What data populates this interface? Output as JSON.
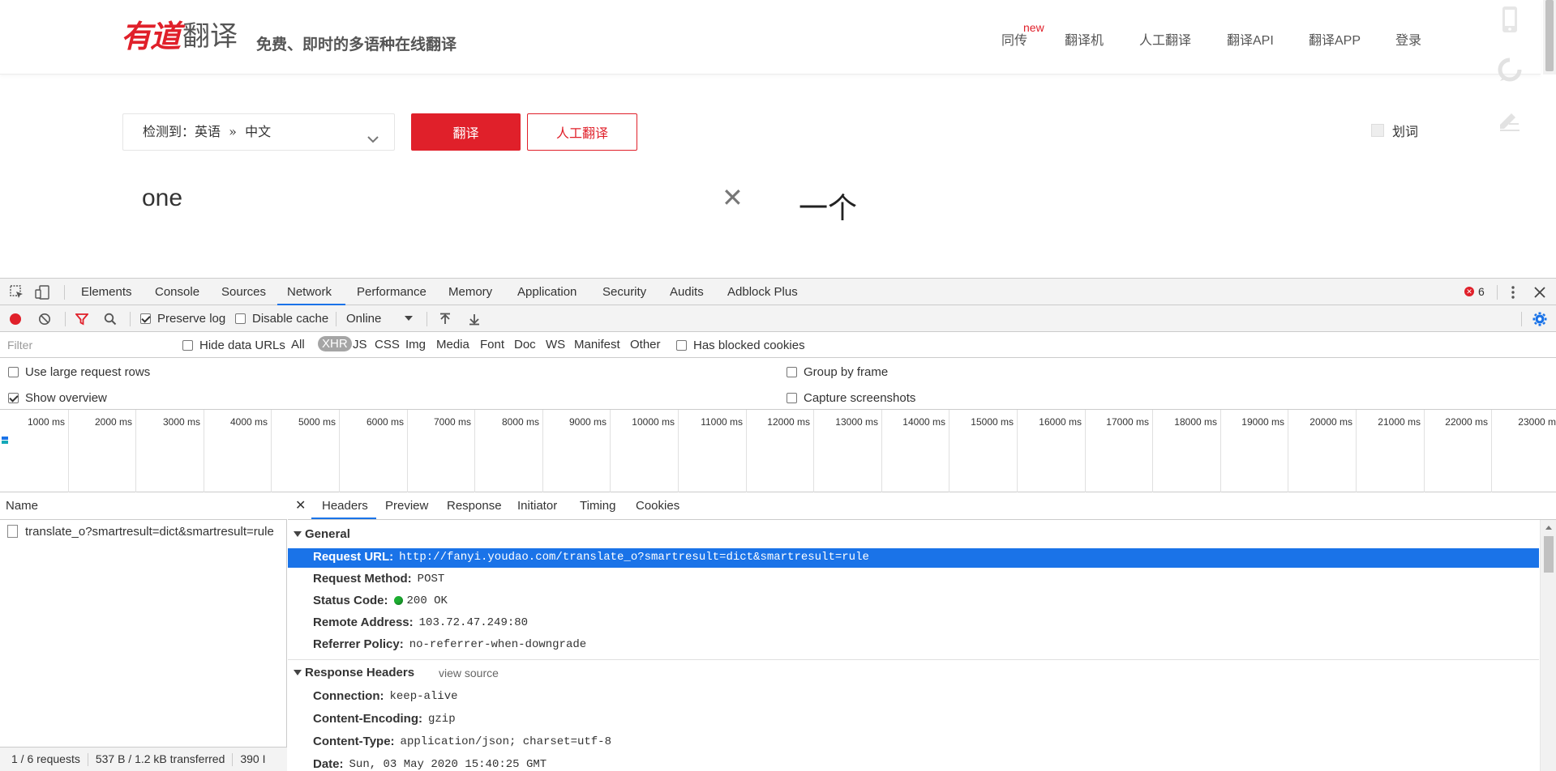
{
  "site": {
    "logo_red": "有道",
    "logo_gray": "翻译",
    "slogan": "免费、即时的多语种在线翻译",
    "nav": {
      "tongchuan": "同传",
      "tongchuan_badge": "new",
      "fanyiji": "翻译机",
      "rengong": "人工翻译",
      "api": "翻译API",
      "app": "翻译APP",
      "login": "登录"
    },
    "side_icons": [
      "phone-icon",
      "feedback-icon",
      "edit-icon"
    ]
  },
  "translator": {
    "language_select": "检测到：英语  »  中文",
    "translate_button": "翻译",
    "human_button": "人工翻译",
    "huaci_label": "划词",
    "input_text": "one",
    "output_text": "一个"
  },
  "devtools": {
    "tabs": [
      "Elements",
      "Console",
      "Sources",
      "Network",
      "Performance",
      "Memory",
      "Application",
      "Security",
      "Audits",
      "Adblock Plus"
    ],
    "active_tab": "Network",
    "error_count": "6",
    "toolbar": {
      "preserve_log": "Preserve log",
      "preserve_log_checked": true,
      "disable_cache": "Disable cache",
      "disable_cache_checked": false,
      "throttling": "Online"
    },
    "filter": {
      "placeholder": "Filter",
      "hide_data_urls": "Hide data URLs",
      "types": [
        "All",
        "XHR",
        "JS",
        "CSS",
        "Img",
        "Media",
        "Font",
        "Doc",
        "WS",
        "Manifest",
        "Other"
      ],
      "active_type": "XHR",
      "has_blocked_cookies": "Has blocked cookies"
    },
    "settings": {
      "use_large_rows": "Use large request rows",
      "show_overview": "Show overview",
      "group_by_frame": "Group by frame",
      "capture_screenshots": "Capture screenshots"
    },
    "overview_ticks": [
      "1000 ms",
      "2000 ms",
      "3000 ms",
      "4000 ms",
      "5000 ms",
      "6000 ms",
      "7000 ms",
      "8000 ms",
      "9000 ms",
      "10000 ms",
      "11000 ms",
      "12000 ms",
      "13000 ms",
      "14000 ms",
      "15000 ms",
      "16000 ms",
      "17000 ms",
      "18000 ms",
      "19000 ms",
      "20000 ms",
      "21000 ms",
      "22000 ms",
      "23000 m"
    ],
    "requests": {
      "header": "Name",
      "rows": [
        "translate_o?smartresult=dict&smartresult=rule"
      ],
      "footer": {
        "count": "1 / 6 requests",
        "transferred": "537 B / 1.2 kB transferred",
        "resources": "390 I"
      }
    },
    "detail": {
      "tabs": [
        "Headers",
        "Preview",
        "Response",
        "Initiator",
        "Timing",
        "Cookies"
      ],
      "active_tab": "Headers",
      "general_title": "General",
      "general": {
        "request_url_k": "Request URL:",
        "request_url_v": "http://fanyi.youdao.com/translate_o?smartresult=dict&smartresult=rule",
        "method_k": "Request Method:",
        "method_v": "POST",
        "status_k": "Status Code:",
        "status_v": "200 OK",
        "remote_k": "Remote Address:",
        "remote_v": "103.72.47.249:80",
        "referrer_k": "Referrer Policy:",
        "referrer_v": "no-referrer-when-downgrade"
      },
      "response_title": "Response Headers",
      "view_source": "view source",
      "response_headers": {
        "connection_k": "Connection:",
        "connection_v": "keep-alive",
        "encoding_k": "Content-Encoding:",
        "encoding_v": "gzip",
        "type_k": "Content-Type:",
        "type_v": "application/json; charset=utf-8",
        "date_k": "Date:",
        "date_v": "Sun, 03 May 2020 15:40:25 GMT"
      }
    }
  }
}
